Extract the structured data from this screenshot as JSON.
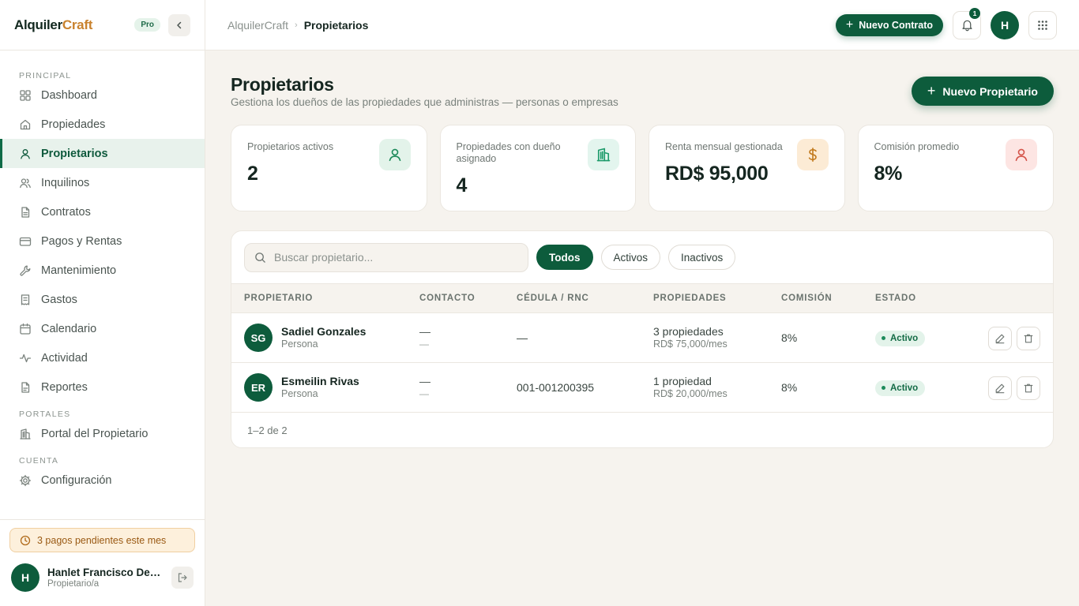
{
  "brand": {
    "name_part1": "Alquiler",
    "name_part2": "Craft",
    "plan_badge": "Pro"
  },
  "sidebar": {
    "sections": [
      {
        "title": "PRINCIPAL",
        "items": [
          {
            "label": "Dashboard",
            "icon": "grid-icon",
            "active": false
          },
          {
            "label": "Propiedades",
            "icon": "home-icon",
            "active": false
          },
          {
            "label": "Propietarios",
            "icon": "user-icon",
            "active": true
          },
          {
            "label": "Inquilinos",
            "icon": "users-icon",
            "active": false
          },
          {
            "label": "Contratos",
            "icon": "file-icon",
            "active": false
          },
          {
            "label": "Pagos y Rentas",
            "icon": "credit-card-icon",
            "active": false
          },
          {
            "label": "Mantenimiento",
            "icon": "wrench-icon",
            "active": false
          },
          {
            "label": "Gastos",
            "icon": "receipt-icon",
            "active": false
          },
          {
            "label": "Calendario",
            "icon": "calendar-icon",
            "active": false
          },
          {
            "label": "Actividad",
            "icon": "activity-icon",
            "active": false
          },
          {
            "label": "Reportes",
            "icon": "report-icon",
            "active": false
          }
        ]
      },
      {
        "title": "PORTALES",
        "items": [
          {
            "label": "Portal del Propietario",
            "icon": "building-icon",
            "active": false
          }
        ]
      },
      {
        "title": "CUENTA",
        "items": [
          {
            "label": "Configuración",
            "icon": "gear-icon",
            "active": false
          }
        ]
      }
    ],
    "pending_alert": "3 pagos pendientes este mes",
    "user": {
      "initial": "H",
      "name": "Hanlet Francisco De L...",
      "role": "Propietario/a"
    }
  },
  "header": {
    "breadcrumb_root": "AlquilerCraft",
    "breadcrumb_current": "Propietarios",
    "new_contract_label": "Nuevo Contrato",
    "notification_count": "1",
    "avatar_initial": "H"
  },
  "page": {
    "title": "Propietarios",
    "subtitle": "Gestiona los dueños de las propiedades que administras — personas o empresas",
    "new_owner_label": "Nuevo Propietario"
  },
  "stats": [
    {
      "label": "Propietarios activos",
      "value": "2",
      "icon": "user-icon",
      "bg": "#e3f3ea",
      "color": "#1c8a5a"
    },
    {
      "label": "Propiedades con dueño asignado",
      "value": "4",
      "icon": "building-icon",
      "bg": "#e3f5ee",
      "color": "#1c9a6a"
    },
    {
      "label": "Renta mensual gestionada",
      "value": "RD$ 95,000",
      "icon": "dollar-icon",
      "bg": "#fcebd5",
      "color": "#c27a1e"
    },
    {
      "label": "Comisión promedio",
      "value": "8%",
      "icon": "user-icon",
      "bg": "#fde5e3",
      "color": "#d4544a"
    }
  ],
  "filters": {
    "search_placeholder": "Buscar propietario...",
    "chips": [
      {
        "label": "Todos",
        "active": true
      },
      {
        "label": "Activos",
        "active": false
      },
      {
        "label": "Inactivos",
        "active": false
      }
    ]
  },
  "table": {
    "columns": [
      "PROPIETARIO",
      "CONTACTO",
      "CÉDULA / RNC",
      "PROPIEDADES",
      "COMISIÓN",
      "ESTADO"
    ],
    "rows": [
      {
        "initials": "SG",
        "name": "Sadiel Gonzales",
        "type": "Persona",
        "contact_main": "—",
        "contact_sub": "—",
        "rnc": "—",
        "properties": "3 propiedades",
        "rent": "RD$ 75,000/mes",
        "commission": "8%",
        "status": "Activo"
      },
      {
        "initials": "ER",
        "name": "Esmeilin Rivas",
        "type": "Persona",
        "contact_main": "—",
        "contact_sub": "—",
        "rnc": "001-001200395",
        "properties": "1 propiedad",
        "rent": "RD$ 20,000/mes",
        "commission": "8%",
        "status": "Activo"
      }
    ],
    "pagination": "1–2 de 2"
  },
  "colors": {
    "brand_green": "#0d5c3c",
    "accent_orange": "#c9822e",
    "background": "#f6f3ee"
  }
}
